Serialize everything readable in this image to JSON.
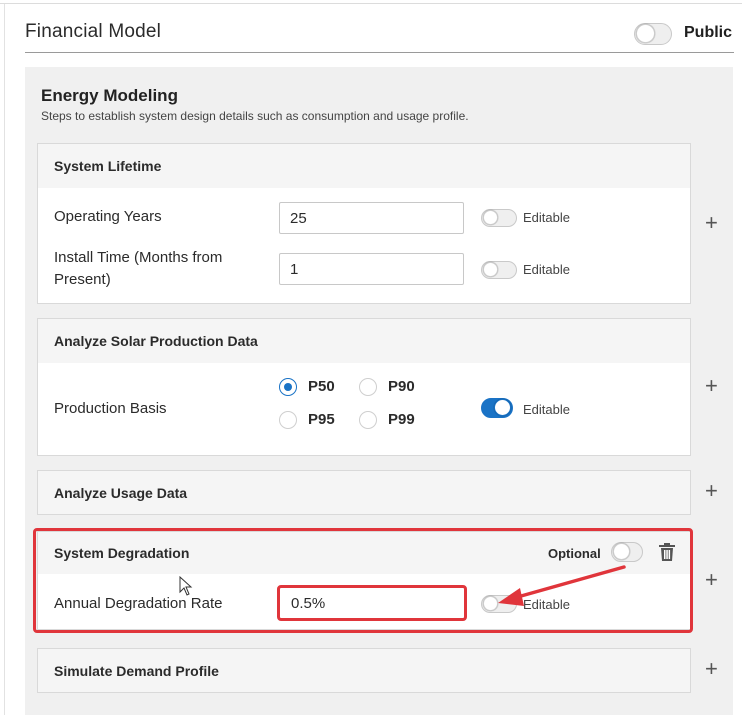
{
  "header": {
    "title": "Financial Model",
    "public_label": "Public",
    "public_on": false
  },
  "section": {
    "title": "Energy Modeling",
    "subtitle": "Steps to establish system design details such as consumption and usage profile."
  },
  "system_lifetime": {
    "title": "System Lifetime",
    "operating_years_label": "Operating Years",
    "operating_years_value": "25",
    "install_time_label_line1": "Install Time (Months from",
    "install_time_label_line2": "Present)",
    "install_time_value": "1",
    "editable_label": "Editable"
  },
  "solar_production": {
    "title": "Analyze Solar Production Data",
    "production_basis_label": "Production Basis",
    "options": [
      "P50",
      "P90",
      "P95",
      "P99"
    ],
    "selected": "P50",
    "editable_label": "Editable",
    "editable_on": true
  },
  "usage_data": {
    "title": "Analyze Usage Data"
  },
  "system_degradation": {
    "title": "System Degradation",
    "optional_label": "Optional",
    "annual_rate_label": "Annual Degradation Rate",
    "annual_rate_value": "0.5%",
    "editable_label": "Editable",
    "editable_on": false
  },
  "demand_profile": {
    "title": "Simulate Demand Profile"
  },
  "icons": {
    "add": "plus-icon",
    "delete": "trash-icon"
  },
  "colors": {
    "accent": "#1a73c6",
    "annotation": "#e0353b",
    "panel_bg": "#f0f0f0"
  }
}
